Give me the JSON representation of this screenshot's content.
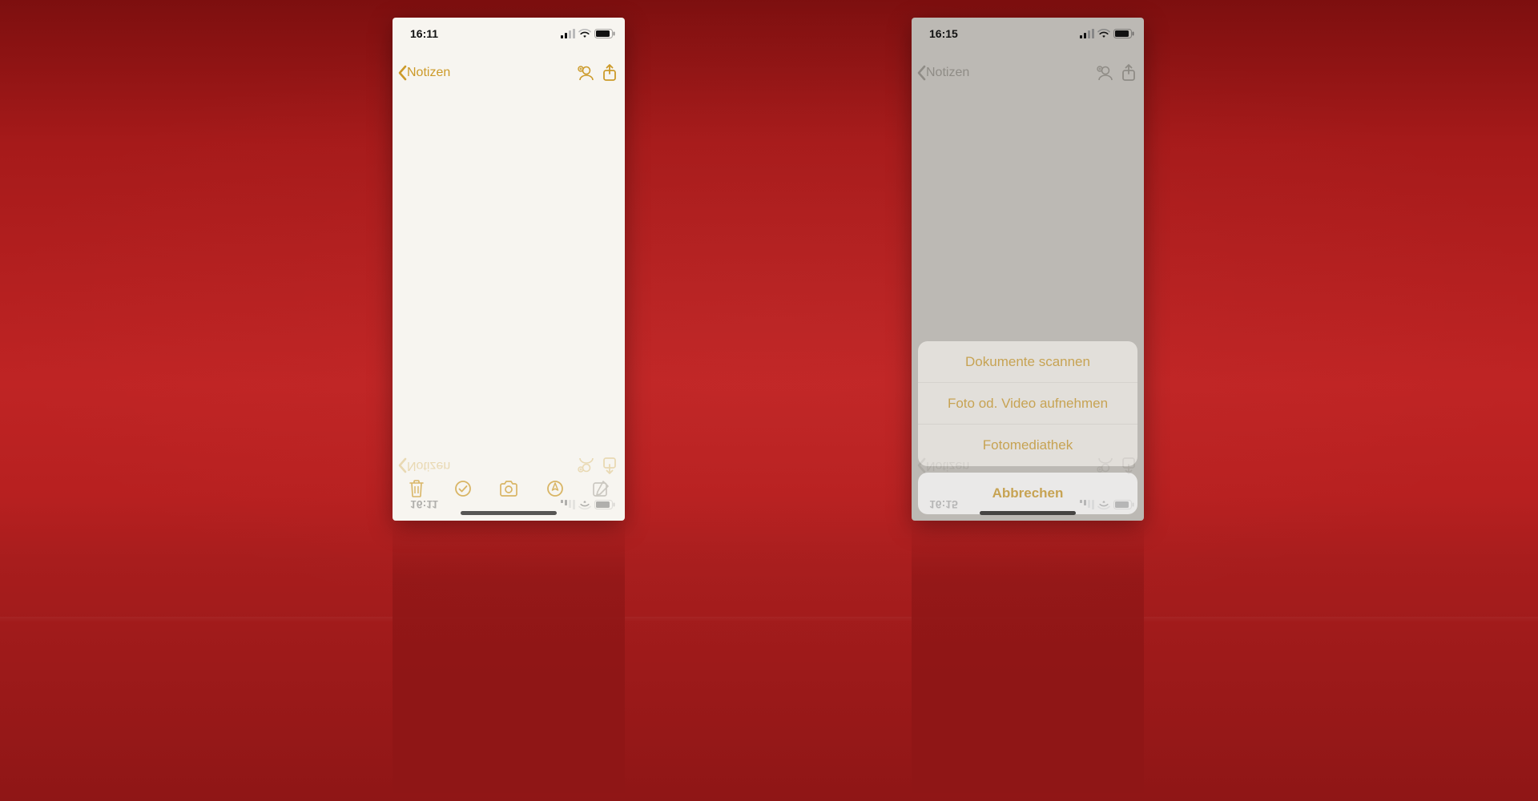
{
  "colors": {
    "accent": "#cc9a29"
  },
  "left": {
    "status": {
      "time": "16:11"
    },
    "nav": {
      "back_label": "Notizen"
    }
  },
  "right": {
    "status": {
      "time": "16:15"
    },
    "nav": {
      "back_label": "Notizen"
    },
    "sheet": {
      "items": [
        "Dokumente scannen",
        "Foto od. Video aufnehmen",
        "Fotomediathek"
      ],
      "cancel": "Abbrechen"
    }
  }
}
